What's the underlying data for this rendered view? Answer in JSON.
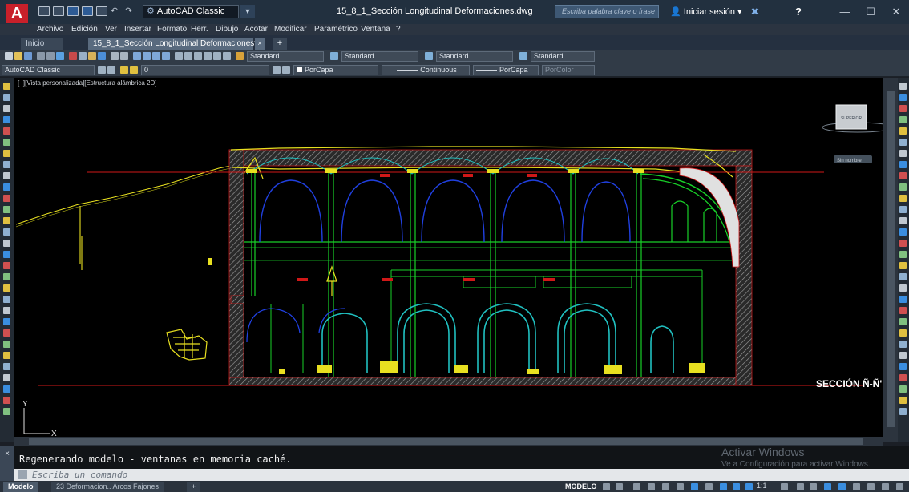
{
  "app": {
    "logo": "A",
    "workspace": "AutoCAD Classic",
    "window_title": "15_8_1_Sección Longitudinal Deformaciones.dwg",
    "search_placeholder": "Escriba palabra clave o frase",
    "signin": "Iniciar sesión",
    "help": "?",
    "minimize": "—",
    "maximize": "☐",
    "close": "✕"
  },
  "menu": [
    "Archivo",
    "Edición",
    "Ver",
    "Insertar",
    "Formato",
    "Herr.",
    "Dibujo",
    "Acotar",
    "Modificar",
    "Paramétrico",
    "Ventana",
    "?"
  ],
  "tabs": {
    "start": "Inicio",
    "active": "15_8_1_Sección Longitudinal Deformaciones*",
    "close": "×",
    "new": "+"
  },
  "styles_toolbar": {
    "text_style": "Standard",
    "dim_style": "Standard",
    "table_style": "Standard",
    "mleader_style": "Standard"
  },
  "layers_toolbar": {
    "workspace": "AutoCAD Classic",
    "layer": "0",
    "color": "PorCapa",
    "linetype": "Continuous",
    "lineweight": "PorCapa",
    "plotstyle": "PorColor"
  },
  "viewport": {
    "label": "[−][Vista personalizada][Estructura alámbrica 2D]",
    "viewcube_face": "SUPERIOR",
    "wcs": "Sin nombre",
    "section_label": "SECCIÓN Ñ-Ñ'",
    "ucs_x": "X",
    "ucs_y": "Y"
  },
  "command": {
    "history": "Regenerando modelo - ventanas en memoria caché.",
    "placeholder": "Escriba un comando",
    "close": "×"
  },
  "watermark": {
    "title": "Activar Windows",
    "subtitle": "Ve a Configuración para activar Windows."
  },
  "layout_tabs": [
    "Modelo",
    "23 Deformacion.. Arcos Fajones"
  ],
  "layout_add": "+",
  "status": {
    "space": "MODELO",
    "scale": "1:1"
  },
  "colors": {
    "titlebar": "#22303f",
    "canvas": "#000000",
    "accent_red": "#c8202a",
    "drawing_green": "#18d028",
    "drawing_yellow": "#e8e020",
    "drawing_blue": "#2040e0",
    "drawing_cyan": "#20c0c0",
    "drawing_red": "#d01818"
  },
  "icons": [
    "new-icon",
    "open-icon",
    "save-icon",
    "saveas-icon",
    "print-icon",
    "undo-icon",
    "redo-icon",
    "workspace-gear-icon",
    "search-icon",
    "user-icon",
    "exchange-icon",
    "help-icon",
    "viewcube-icon",
    "ucs-icon",
    "command-icon"
  ]
}
